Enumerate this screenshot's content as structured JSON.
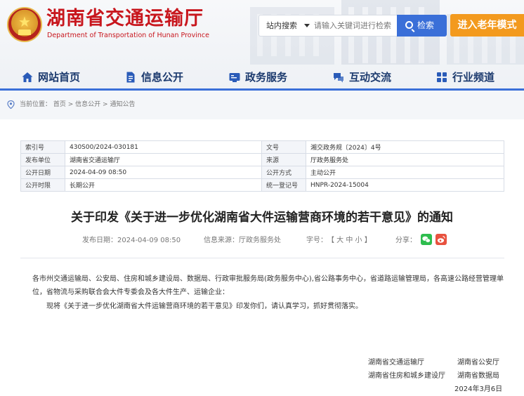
{
  "header": {
    "site_title": "湖南省交通运输厅",
    "site_subtitle": "Department of Transportation of Hunan Province",
    "search_scope": "站内搜索",
    "search_placeholder": "请输入关键词进行检索",
    "search_button": "检索",
    "elder_mode": "进入老年模式"
  },
  "nav": {
    "items": [
      {
        "label": "网站首页",
        "icon": "home-icon"
      },
      {
        "label": "信息公开",
        "icon": "document-icon"
      },
      {
        "label": "政务服务",
        "icon": "service-icon"
      },
      {
        "label": "互动交流",
        "icon": "chat-icon"
      },
      {
        "label": "行业频道",
        "icon": "grid-icon"
      }
    ],
    "accent_color": "#3a6fd8"
  },
  "breadcrumb": {
    "label": "当前位置：",
    "items": [
      "首页",
      "信息公开",
      "通知公告"
    ],
    "separator": " > "
  },
  "meta_table": {
    "rows": [
      [
        {
          "k": "索引号",
          "v": "430S00/2024-030181"
        },
        {
          "k": "文号",
          "v": "湘交政务规〔2024〕4号"
        }
      ],
      [
        {
          "k": "发布单位",
          "v": "湖南省交通运输厅"
        },
        {
          "k": "来源",
          "v": "厅政务服务处"
        }
      ],
      [
        {
          "k": "公开日期",
          "v": "2024-04-09 08:50"
        },
        {
          "k": "公开方式",
          "v": "主动公开"
        }
      ],
      [
        {
          "k": "公开时限",
          "v": "长期公开"
        },
        {
          "k": "统一登记号",
          "v": "HNPR-2024-15004"
        }
      ]
    ]
  },
  "article": {
    "title": "关于印发《关于进一步优化湖南省大件运输营商环境的若干意见》的通知",
    "publish_date": "发布日期：2024-04-09 08:50",
    "source": "信息来源：厅政务服务处",
    "font_size_label": "字号：",
    "font_size_options": "【 大 中 小 】",
    "share_label": "分享：",
    "paragraphs": [
      "各市州交通运输局、公安局、住房和城乡建设局、数据局、行政审批服务局(政务服务中心),省公路事务中心，省道路运输管理局，各高速公路经营管理单",
      "位，省物流与采购联合会大件专委会及各大件生产、运输企业：",
      "现将《关于进一步优化湖南省大件运输营商环境的若干意见》印发你们，请认真学习，抓好贯彻落实。"
    ],
    "signatories": {
      "row1_left": "湖南省交通运输厅",
      "row1_right": "湖南省公安厅",
      "row2_left": "湖南省住房和城乡建设厅",
      "row2_right": "湖南省数据局",
      "date": "2024年3月6日"
    }
  },
  "colors": {
    "brand_red": "#c8161d",
    "elder_orange": "#f39a1e",
    "wechat_green": "#2ebd4e",
    "weibo_red": "#e8523f"
  }
}
